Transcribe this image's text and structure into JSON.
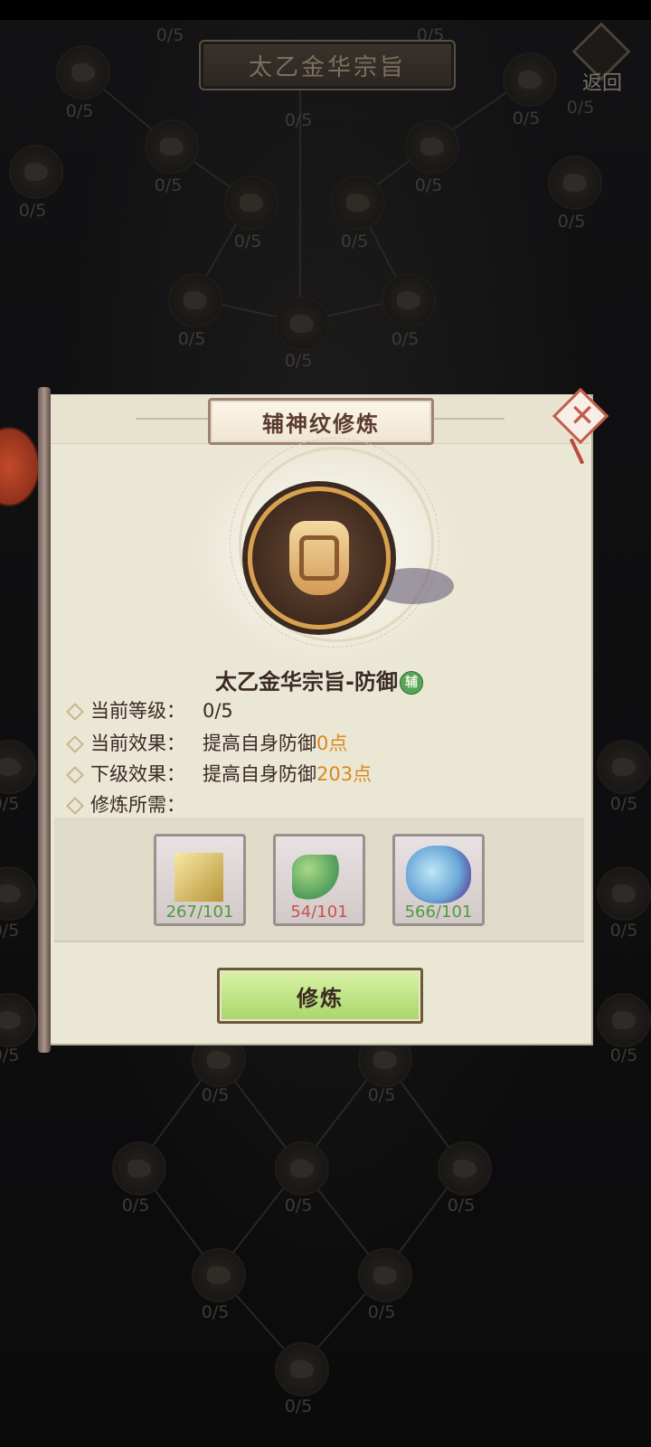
{
  "screen_title": "太乙金华宗旨",
  "back_label": "返回",
  "tree_nodes": [
    {
      "label": "0/5"
    },
    {
      "label": "0/5"
    },
    {
      "label": "0/5"
    },
    {
      "label": "0/5"
    },
    {
      "label": "0/5"
    },
    {
      "label": "0/5"
    },
    {
      "label": "0/5"
    },
    {
      "label": "0/5"
    },
    {
      "label": "0/5"
    },
    {
      "label": "0/5"
    },
    {
      "label": "0/5"
    },
    {
      "label": "0/5"
    },
    {
      "label": "0/5"
    },
    {
      "label": "0/5"
    },
    {
      "label": "0/5"
    },
    {
      "label": "0/5"
    },
    {
      "label": "0/5"
    },
    {
      "label": "0/5"
    },
    {
      "label": "0/5"
    },
    {
      "label": "0/5"
    },
    {
      "label": "0/5"
    },
    {
      "label": "0/5"
    },
    {
      "label": "0/5"
    },
    {
      "label": "0/5"
    },
    {
      "label": "0/5"
    },
    {
      "label": "0/5"
    },
    {
      "label": "0/5"
    },
    {
      "label": "0/5"
    },
    {
      "label": "0/5"
    },
    {
      "label": "0/5"
    }
  ],
  "dialog": {
    "title": "辅神纹修炼",
    "skill_name": "太乙金华宗旨-防御",
    "skill_badge": "辅",
    "current_level_label": "当前等级：",
    "current_level_value": "0/5",
    "current_effect_label": "当前效果：",
    "current_effect_text": "提高自身防御",
    "current_effect_value": "0点",
    "next_effect_label": "下级效果：",
    "next_effect_text": "提高自身防御",
    "next_effect_value": "203点",
    "requirement_label": "修炼所需：",
    "materials": [
      {
        "icon": "gold-crystal-icon",
        "count": "267/101",
        "sufficient": true
      },
      {
        "icon": "jade-branch-icon",
        "count": "54/101",
        "sufficient": false
      },
      {
        "icon": "water-spirit-icon",
        "count": "566/101",
        "sufficient": true
      }
    ],
    "train_button": "修炼"
  },
  "colors": {
    "highlight": "#d8891f",
    "sufficient": "#4f9a3e",
    "insufficient": "#c8524e",
    "button": "#b8de7a"
  }
}
